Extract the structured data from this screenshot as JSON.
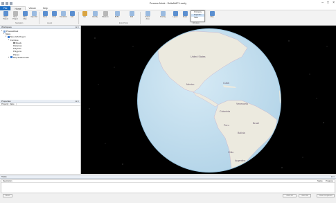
{
  "window": {
    "title": "Process Mock - DeltaMAP Lovely"
  },
  "tabs": [
    "File",
    "Home",
    "Viewer",
    "Help"
  ],
  "ribbon": {
    "buttons": [
      "Open Project",
      "Save Project",
      "Save Map",
      "Open All",
      "Redo",
      "Undo",
      "Transform",
      "Add",
      "Set",
      "Identify",
      "Measure",
      "Buffer",
      "Edit",
      "Select Area",
      "Overlay",
      "Layers",
      "Reset",
      "Map"
    ],
    "groups": [
      "Navigation",
      "Layout",
      "Extra Points",
      "Windows"
    ],
    "popup_items": [
      "Workspace",
      "Properties",
      "Tasks"
    ]
  },
  "workspace": {
    "header": "Workspace",
    "tree": [
      "ProcessMock",
      "Maps",
      "Sites GIS Project",
      "Furniture",
      "Roads",
      "Distances",
      "Polylines",
      "Polygons",
      "Planes",
      "Strip Shadow Edit"
    ]
  },
  "properties": {
    "header": "Properties",
    "columns": [
      "Property",
      "Value"
    ]
  },
  "map": {
    "labels": [
      "United States",
      "Mexico",
      "Cuba",
      "Venezuela",
      "Colombia",
      "Peru",
      "Brazil",
      "Bolivia",
      "Chile",
      "Argentina"
    ]
  },
  "tasks": {
    "header": "Tasks",
    "columns": [
      "Description",
      "Status",
      "Progress"
    ],
    "buttons": [
      "Reset",
      "Abort all",
      "Abort All",
      "Clear Completed"
    ]
  }
}
